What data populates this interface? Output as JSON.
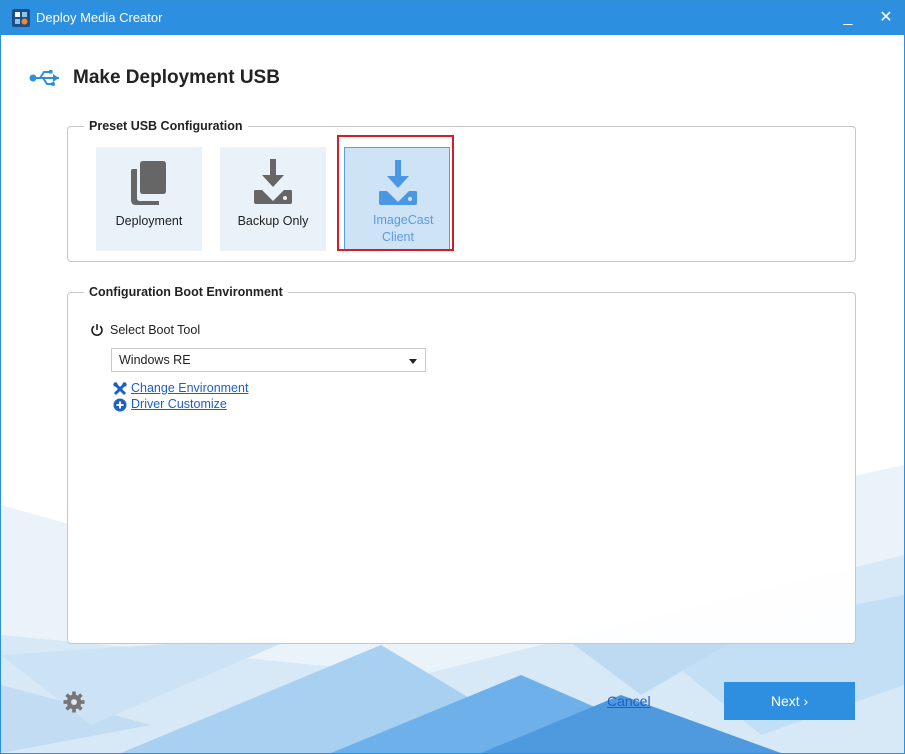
{
  "window": {
    "title": "Deploy Media Creator",
    "minimize_glyph": "_",
    "close_glyph": "✕"
  },
  "page": {
    "title": "Make Deployment USB",
    "icon": "usb-icon"
  },
  "preset": {
    "legend": "Preset USB Configuration",
    "tiles": [
      {
        "label": "Deployment",
        "icon": "documents-icon",
        "selected": false
      },
      {
        "label": "Backup Only",
        "icon": "download-drive-icon",
        "selected": false
      },
      {
        "label": "ImageCast Client",
        "icon": "download-drive-icon",
        "selected": true
      }
    ]
  },
  "boot": {
    "legend": "Configuration Boot Environment",
    "select_label": "Select Boot Tool",
    "selected_tool": "Windows RE",
    "links": [
      {
        "label": "Change Environment",
        "icon": "tools-icon"
      },
      {
        "label": "Driver Customize",
        "icon": "plus-circle-icon"
      }
    ]
  },
  "footer": {
    "settings_icon": "gear-icon",
    "cancel_label": "Cancel",
    "next_label": "Next ›"
  },
  "colors": {
    "accent": "#2d8fe0",
    "link": "#1c5fc9",
    "selection_outline": "#d11e2a",
    "tile_bg": "#e9f1f9",
    "tile_selected_bg": "#cfe3f6"
  }
}
